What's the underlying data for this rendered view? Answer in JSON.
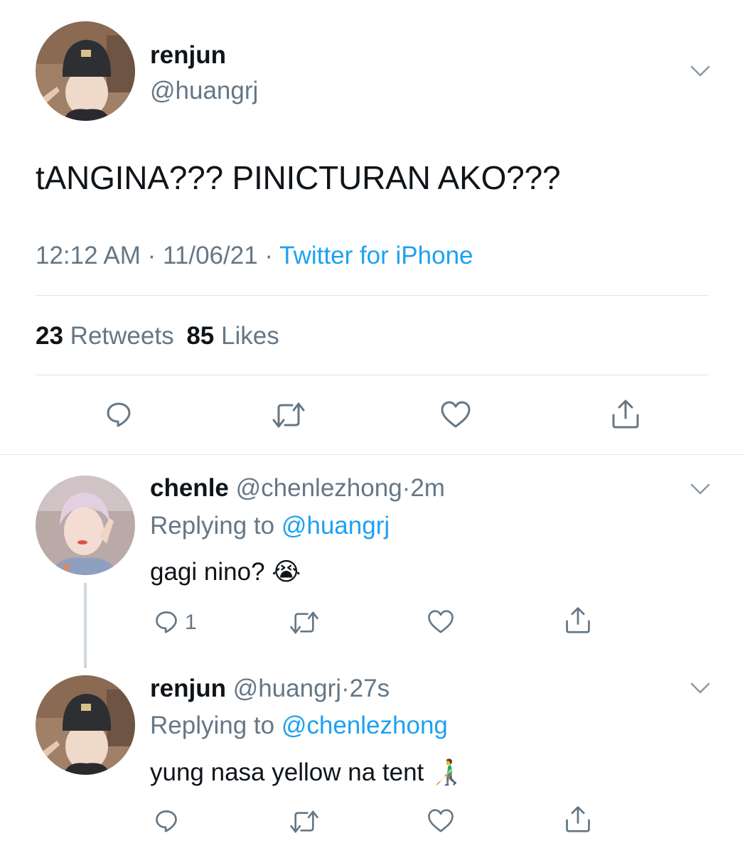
{
  "main_tweet": {
    "display_name": "renjun",
    "handle": "@huangrj",
    "text": "tANGINA??? PINICTURAN AKO???",
    "time": "12:12 AM",
    "date": "11/06/21",
    "separator": "·",
    "source": "Twitter for iPhone",
    "retweets_count": "23",
    "retweets_label": "Retweets",
    "likes_count": "85",
    "likes_label": "Likes"
  },
  "replies": [
    {
      "display_name": "chenle",
      "handle": "@chenlezhong",
      "separator": "·",
      "age": "2m",
      "replying_prefix": "Replying to",
      "replying_to": "@huangrj",
      "text": "gagi nino?",
      "emoji": "😭",
      "reply_count": "1"
    },
    {
      "display_name": "renjun",
      "handle": "@huangrj",
      "separator": "·",
      "age": "27s",
      "replying_prefix": "Replying to",
      "replying_to": "@chenlezhong",
      "text": "yung nasa yellow na tent",
      "emoji": "👨‍🦯",
      "reply_count": ""
    }
  ],
  "icons": {
    "reply": "reply-icon",
    "retweet": "retweet-icon",
    "like": "like-icon",
    "share": "share-icon",
    "more": "chevron-down-icon"
  },
  "colors": {
    "text": "#0f1419",
    "muted": "#657786",
    "accent": "#1da1f2",
    "divider": "#dfe3e6"
  }
}
